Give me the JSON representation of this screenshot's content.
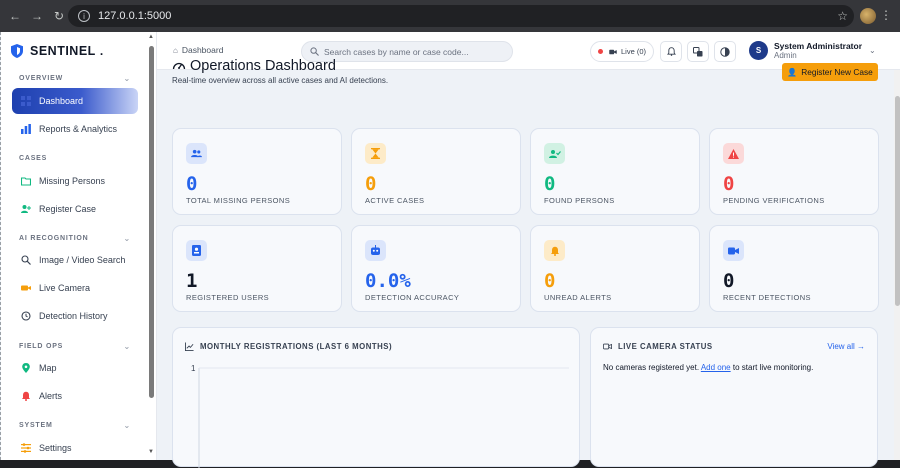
{
  "browser": {
    "url": "127.0.0.1:5000"
  },
  "sidebar": {
    "brand": "SENTINEL",
    "brand_dot": ".",
    "sections": [
      {
        "label": "OVERVIEW",
        "items": [
          {
            "label": "Dashboard",
            "icon": "dashboard-icon",
            "active": true
          },
          {
            "label": "Reports & Analytics",
            "icon": "bar-chart-icon"
          }
        ]
      },
      {
        "label": "CASES",
        "items": [
          {
            "label": "Missing Persons",
            "icon": "folder-icon"
          },
          {
            "label": "Register Case",
            "icon": "user-plus-icon"
          }
        ]
      },
      {
        "label": "AI RECOGNITION",
        "items": [
          {
            "label": "Image / Video Search",
            "icon": "search-icon"
          },
          {
            "label": "Live Camera",
            "icon": "camera-icon"
          },
          {
            "label": "Detection History",
            "icon": "history-icon"
          }
        ]
      },
      {
        "label": "FIELD OPS",
        "items": [
          {
            "label": "Map",
            "icon": "map-pin-icon"
          },
          {
            "label": "Alerts",
            "icon": "bell-icon"
          }
        ]
      },
      {
        "label": "SYSTEM",
        "items": [
          {
            "label": "Settings",
            "icon": "settings-icon"
          }
        ]
      }
    ]
  },
  "header": {
    "breadcrumb": "Dashboard",
    "search_placeholder": "Search cases by name or case code...",
    "live_label": "Live (0)",
    "user": {
      "initial": "S",
      "name": "System Administrator",
      "role": "Admin"
    }
  },
  "main": {
    "title": "Operations Dashboard",
    "subtitle": "Real-time overview across all active cases and AI detections.",
    "register_button": "Register New Case",
    "stats": [
      {
        "value": "0",
        "label": "TOTAL MISSING PERSONS",
        "color": "#2563eb",
        "bg": "#dbe5fb",
        "icon": "users-icon"
      },
      {
        "value": "0",
        "label": "ACTIVE CASES",
        "color": "#f59e0b",
        "bg": "#fdebc8",
        "icon": "hourglass-icon"
      },
      {
        "value": "0",
        "label": "FOUND PERSONS",
        "color": "#10b981",
        "bg": "#d1f1e3",
        "icon": "user-check-icon"
      },
      {
        "value": "0",
        "label": "PENDING VERIFICATIONS",
        "color": "#ef4444",
        "bg": "#fbd9d9",
        "icon": "warning-icon"
      },
      {
        "value": "1",
        "label": "REGISTERED USERS",
        "color": "#111827",
        "bg": "#dbe5fb",
        "icon": "id-badge-icon"
      },
      {
        "value": "0.0%",
        "label": "DETECTION ACCURACY",
        "color": "#2563eb",
        "bg": "#dbe5fb",
        "icon": "robot-icon"
      },
      {
        "value": "0",
        "label": "UNREAD ALERTS",
        "color": "#f59e0b",
        "bg": "#fdebc8",
        "icon": "bell-icon"
      },
      {
        "value": "0",
        "label": "RECENT DETECTIONS",
        "color": "#111827",
        "bg": "#dbe5fb",
        "icon": "video-icon"
      }
    ],
    "monthly": {
      "title": "MONTHLY REGISTRATIONS (LAST 6 MONTHS)",
      "chart_data": {
        "type": "line",
        "series": [],
        "ylim": [
          0,
          1
        ],
        "y_ticks": [
          "1"
        ]
      }
    },
    "camera": {
      "title": "LIVE CAMERA STATUS",
      "view_all": "View all →",
      "text_before": "No cameras registered yet.",
      "link": "Add one",
      "text_after": "to start live monitoring."
    }
  }
}
